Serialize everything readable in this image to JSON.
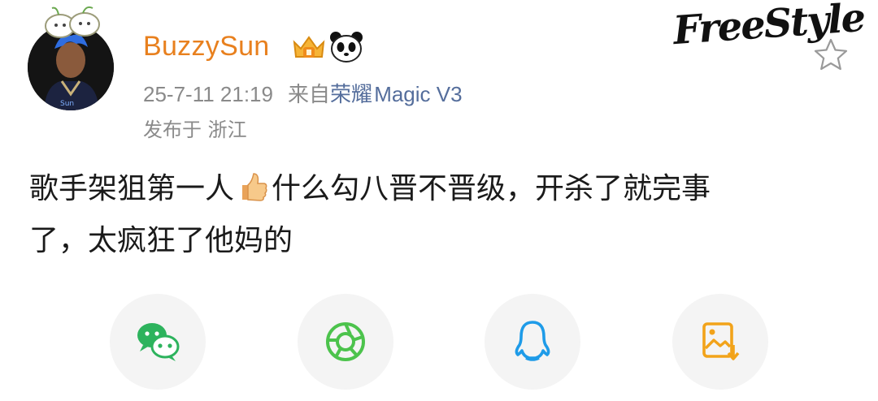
{
  "user": {
    "name": "BuzzySun"
  },
  "meta": {
    "timestamp": "25-7-11 21:19",
    "from_prefix": "来自",
    "device_brand": "荣耀",
    "device_model": "Magic V3",
    "location": "发布于 浙江"
  },
  "watermark": {
    "logo_text": "FreeStyle"
  },
  "post": {
    "line1_part1": "歌手架狙第一人",
    "line1_part2": "什么勾八晋不晋级，开杀了就完事",
    "line2": "了，太疯狂了他妈的"
  },
  "share": {
    "buttons": [
      "wechat-icon",
      "moments-icon",
      "qq-icon",
      "save-image-icon"
    ]
  },
  "colors": {
    "username": "#e8801e",
    "brand_link": "#556e9c",
    "meta_gray": "#8a8a8a",
    "wechat_green": "#2db35d",
    "moments_green": "#4cc34c",
    "qq_blue": "#1e9be8",
    "save_orange": "#f2a31a"
  }
}
